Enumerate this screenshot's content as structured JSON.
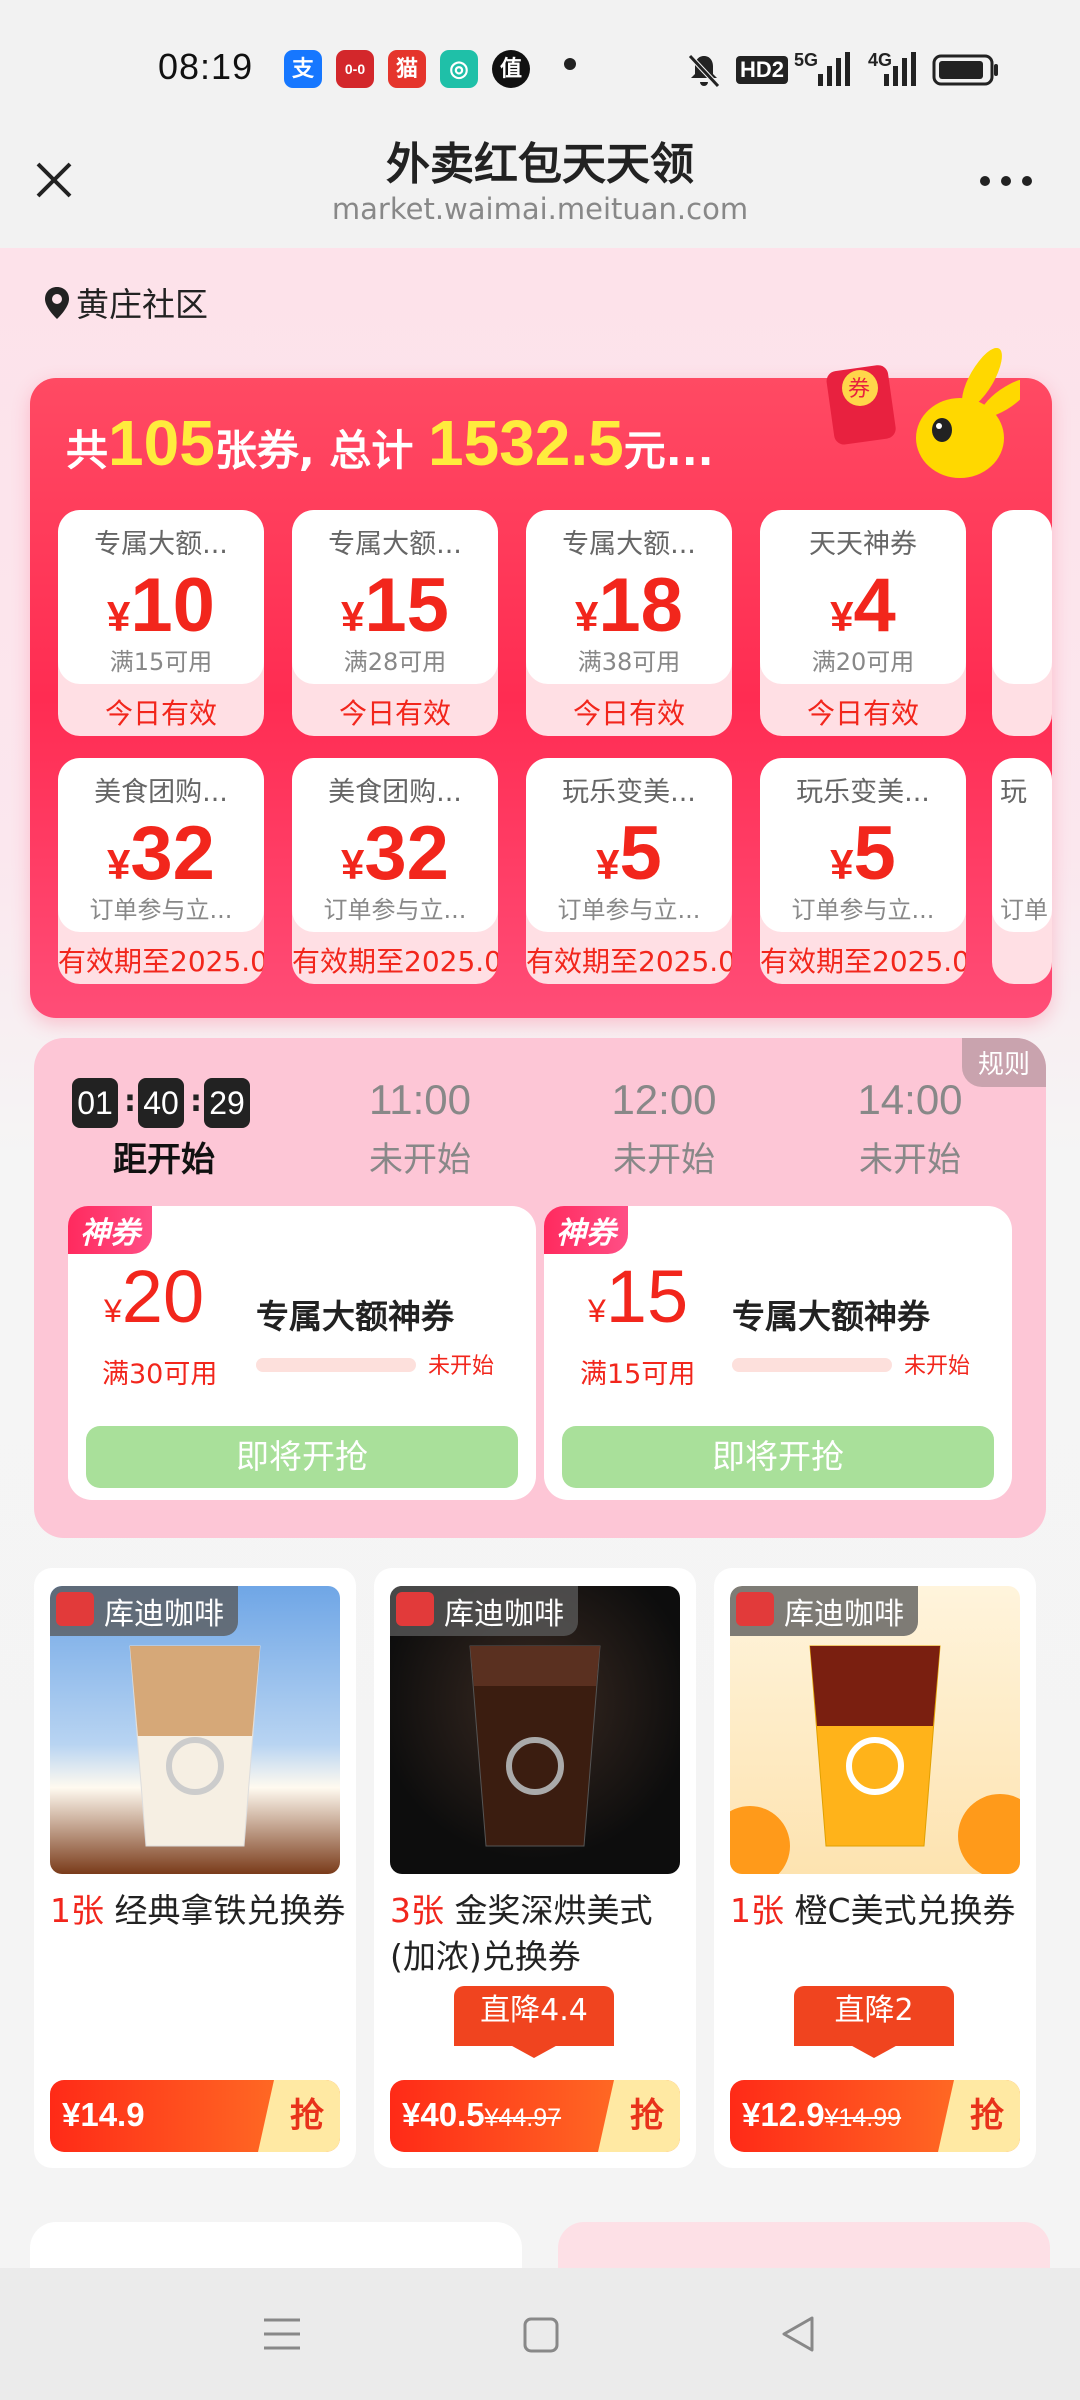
{
  "status_bar": {
    "time": "08:19",
    "apps": [
      "支",
      "0-0",
      "猫",
      "◎",
      "值"
    ],
    "network": "5G",
    "network2": "4G",
    "hd": "HD2"
  },
  "nav": {
    "title": "外卖红包天天领",
    "url": "market.waimai.meituan.com"
  },
  "location": "黄庄社区",
  "coupon_summary": {
    "prefix": "共",
    "count": "105",
    "mid": "张券, 总计",
    "total": "1532.5",
    "suffix": "元..."
  },
  "coupons": [
    {
      "title": "专属大额...",
      "currency": "¥",
      "amount": "10",
      "cond": "满15可用",
      "validity": "今日有效"
    },
    {
      "title": "专属大额...",
      "currency": "¥",
      "amount": "15",
      "cond": "满28可用",
      "validity": "今日有效"
    },
    {
      "title": "专属大额...",
      "currency": "¥",
      "amount": "18",
      "cond": "满38可用",
      "validity": "今日有效"
    },
    {
      "title": "天天神券",
      "currency": "¥",
      "amount": "4",
      "cond": "满20可用",
      "validity": "今日有效"
    },
    {
      "title": "美食团购...",
      "currency": "¥",
      "amount": "32",
      "cond": "订单参与立...",
      "validity": "有效期至2025.0"
    },
    {
      "title": "美食团购...",
      "currency": "¥",
      "amount": "32",
      "cond": "订单参与立...",
      "validity": "有效期至2025.0"
    },
    {
      "title": "玩乐变美...",
      "currency": "¥",
      "amount": "5",
      "cond": "订单参与立...",
      "validity": "有效期至2025.0"
    },
    {
      "title": "玩乐变美...",
      "currency": "¥",
      "amount": "5",
      "cond": "订单参与立...",
      "validity": "有效期至2025.0"
    }
  ],
  "coupon_peek_2": "玩",
  "coupon_peek_2b": "订单",
  "flash_sale": {
    "rules": "规则",
    "countdown": {
      "h": "01",
      "m": "40",
      "s": "29"
    },
    "countdown_label": "距开始",
    "slots": [
      {
        "time": "11:00",
        "status": "未开始"
      },
      {
        "time": "12:00",
        "status": "未开始"
      },
      {
        "time": "14:00",
        "status": "未开始"
      }
    ],
    "deals": [
      {
        "tag": "神券",
        "currency": "¥",
        "amount": "20",
        "cond": "满30可用",
        "name": "专属大额神券",
        "status": "未开始",
        "button": "即将开抢",
        "progress": 0
      },
      {
        "tag": "神券",
        "currency": "¥",
        "amount": "15",
        "cond": "满15可用",
        "name": "专属大额神券",
        "status": "未开始",
        "button": "即将开抢",
        "progress": 0
      }
    ]
  },
  "products": [
    {
      "brand": "库迪咖啡",
      "count": "1张",
      "title": "经典拿铁兑换券",
      "drop": "",
      "price": "¥14.9",
      "orig": "",
      "grab": "抢"
    },
    {
      "brand": "库迪咖啡",
      "count": "3张",
      "title": "金奖深烘美式(加浓)兑换券",
      "drop": "直降4.4",
      "price": "¥40.5",
      "orig": "¥44.97",
      "grab": "抢"
    },
    {
      "brand": "库迪咖啡",
      "count": "1张",
      "title": "橙C美式兑换券",
      "drop": "直降2",
      "price": "¥12.9",
      "orig": "¥14.99",
      "grab": "抢"
    }
  ],
  "colors": {
    "accent": "#f2261c",
    "panel": "#ff2c52",
    "flash_bg": "#fdc6d6"
  }
}
